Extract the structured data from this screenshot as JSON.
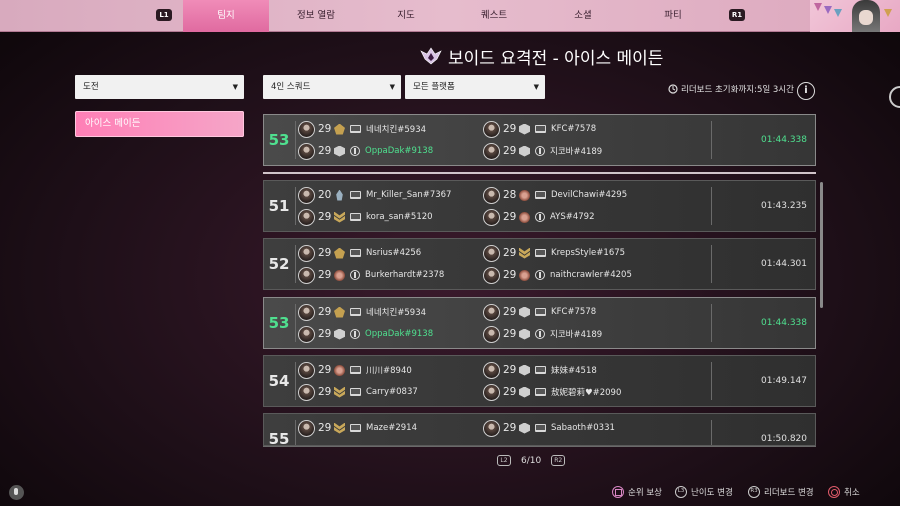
{
  "nav": {
    "left_button": "L1",
    "right_button": "R1",
    "tabs": [
      "팀지",
      "정보 열람",
      "지도",
      "퀘스트",
      "소셜",
      "파티"
    ],
    "active_index": 0
  },
  "title": "보이드 요격전 - 아이스 메이든",
  "filters": {
    "category": "도전",
    "squad": "4인 스쿼드",
    "platform": "모든 플랫폼"
  },
  "sidebar": {
    "selected": "아이스 메이든"
  },
  "reset_text": "리더보드 초기화까지:5일 3시간",
  "info_icon": "i",
  "my_entry": {
    "rank": "53",
    "time": "01:44.338",
    "players": [
      {
        "level": "29",
        "name": "네네치킨#5934",
        "rank_icon": "gold",
        "platform": "pc"
      },
      {
        "level": "29",
        "name": "KFC#7578",
        "rank_icon": "silver",
        "platform": "pc"
      },
      {
        "level": "29",
        "name": "OppaDak#9138",
        "rank_icon": "silver",
        "platform": "ps",
        "highlight": true
      },
      {
        "level": "29",
        "name": "지코바#4189",
        "rank_icon": "silver",
        "platform": "ps"
      }
    ]
  },
  "entries": [
    {
      "rank": "51",
      "time": "01:43.235",
      "players": [
        {
          "level": "20",
          "name": "Mr_Killer_San#7367",
          "rank_icon": "flame",
          "platform": "pc"
        },
        {
          "level": "28",
          "name": "DevilChawi#4295",
          "rank_icon": "bronze",
          "platform": "pc"
        },
        {
          "level": "29",
          "name": "kora_san#5120",
          "rank_icon": "chev",
          "platform": "pc"
        },
        {
          "level": "29",
          "name": "AYS#4792",
          "rank_icon": "bronze",
          "platform": "ps"
        }
      ]
    },
    {
      "rank": "52",
      "time": "01:44.301",
      "players": [
        {
          "level": "29",
          "name": "Nsrius#4256",
          "rank_icon": "gold",
          "platform": "pc"
        },
        {
          "level": "29",
          "name": "KrepsStyle#1675",
          "rank_icon": "chev",
          "platform": "pc"
        },
        {
          "level": "29",
          "name": "Burkerhardt#2378",
          "rank_icon": "bronze",
          "platform": "ps"
        },
        {
          "level": "29",
          "name": "naithcrawler#4205",
          "rank_icon": "bronze",
          "platform": "ps"
        }
      ]
    },
    {
      "rank": "53",
      "time": "01:44.338",
      "highlight": true,
      "players": [
        {
          "level": "29",
          "name": "네네치킨#5934",
          "rank_icon": "gold",
          "platform": "pc"
        },
        {
          "level": "29",
          "name": "KFC#7578",
          "rank_icon": "silver",
          "platform": "pc"
        },
        {
          "level": "29",
          "name": "OppaDak#9138",
          "rank_icon": "silver",
          "platform": "ps",
          "highlight": true
        },
        {
          "level": "29",
          "name": "지코바#4189",
          "rank_icon": "silver",
          "platform": "ps"
        }
      ]
    },
    {
      "rank": "54",
      "time": "01:49.147",
      "players": [
        {
          "level": "29",
          "name": "川川#8940",
          "rank_icon": "bronze",
          "platform": "pc"
        },
        {
          "level": "29",
          "name": "妹妹#4518",
          "rank_icon": "silver",
          "platform": "pc"
        },
        {
          "level": "29",
          "name": "Carry#0837",
          "rank_icon": "chev",
          "platform": "pc"
        },
        {
          "level": "29",
          "name": "敖妮碧莉♥#2090",
          "rank_icon": "silver",
          "platform": "pc"
        }
      ]
    },
    {
      "rank": "55",
      "time": "01:50.820",
      "players": [
        {
          "level": "29",
          "name": "Maze#2914",
          "rank_icon": "chev",
          "platform": "pc"
        },
        {
          "level": "29",
          "name": "Sabaoth#0331",
          "rank_icon": "silver",
          "platform": "pc"
        }
      ]
    }
  ],
  "pager": {
    "prev": "L2",
    "text": "6/10",
    "next": "R2"
  },
  "footer": [
    {
      "icon": "square",
      "label": "순위 보상"
    },
    {
      "icon": "L3",
      "label": "난이도 변경"
    },
    {
      "icon": "R3",
      "label": "리더보드 변경"
    },
    {
      "icon": "circle",
      "label": "취소"
    }
  ],
  "colors": {
    "accent": "#f08cb8",
    "green": "#4fe08f"
  }
}
